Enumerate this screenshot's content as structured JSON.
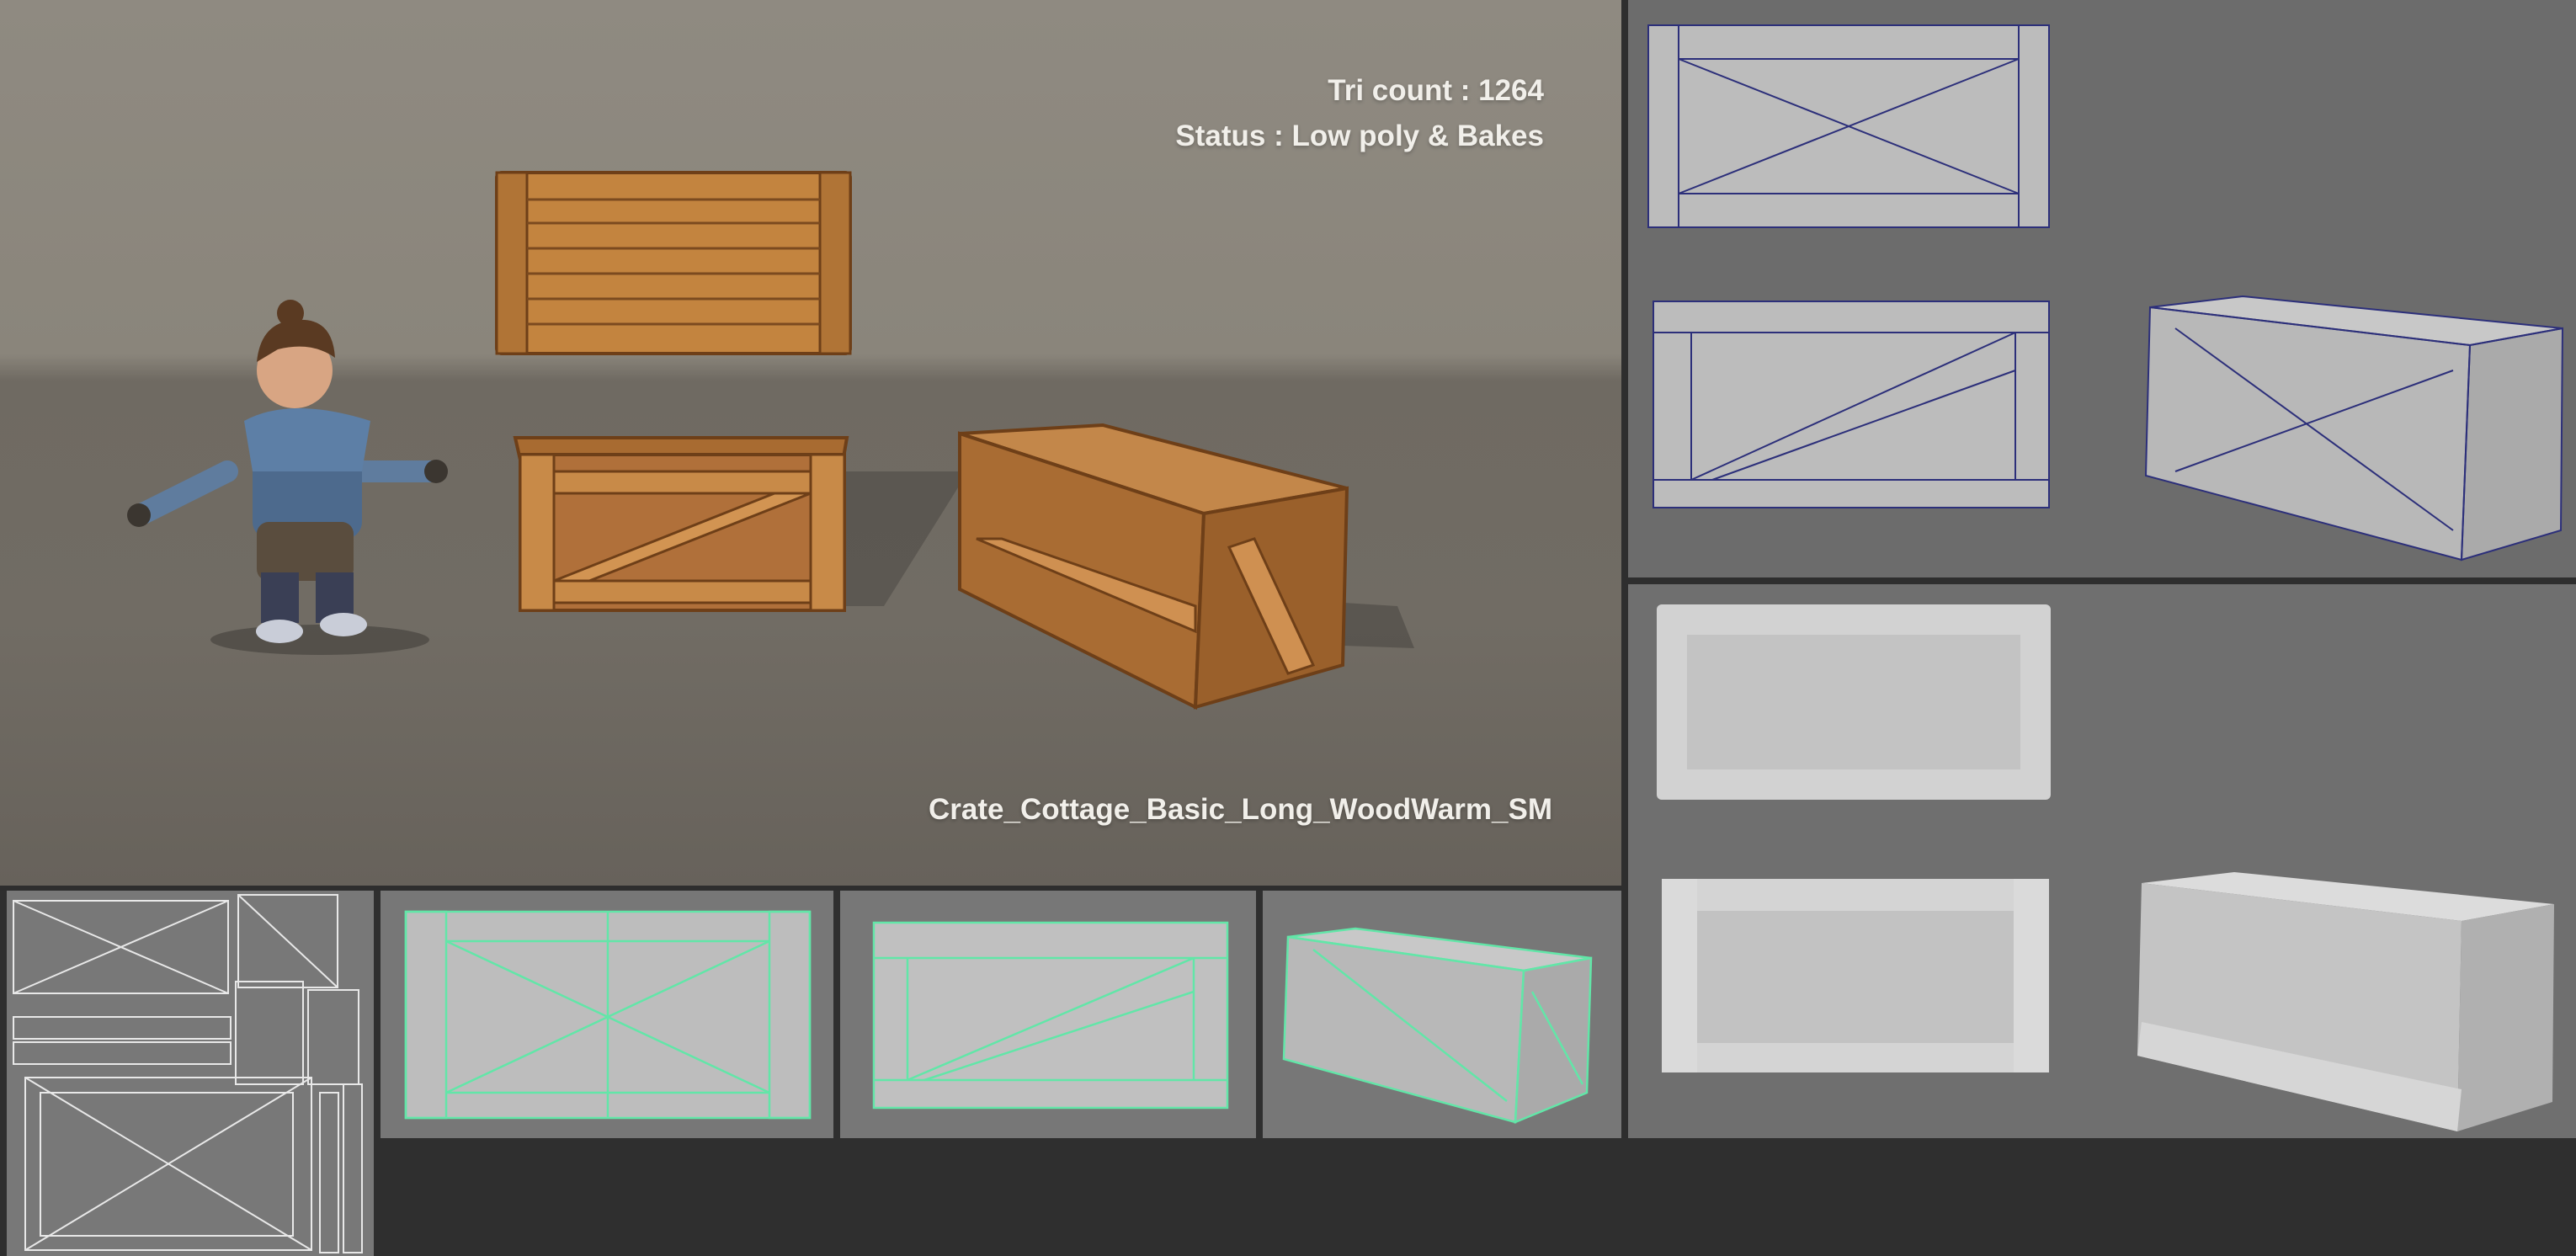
{
  "hero": {
    "tri_count": "Tri count : 1264",
    "status": "Status : Low poly & Bakes",
    "asset_name": "Crate_Cottage_Basic_Long_WoodWarm_SM"
  },
  "colors": {
    "background": "#2f2f2f",
    "scene_wall": "#8f8a81",
    "scene_floor": "#716c64",
    "wood_light": "#c98a48",
    "wood_dark": "#8a5424",
    "wire_blue": "#2c2f7a",
    "wire_green": "#62e6a8",
    "clay_grey": "#b4b4b4"
  },
  "icons": {
    "character": "stylized-character-figure",
    "crate": "wooden-crate"
  }
}
